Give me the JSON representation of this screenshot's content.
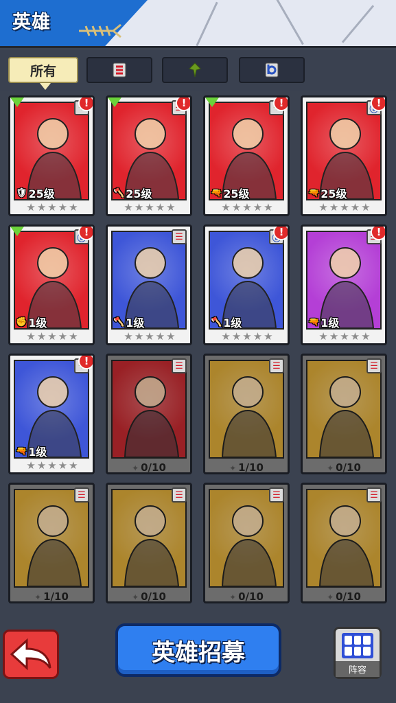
{
  "header": {
    "title": "英雄"
  },
  "filters": [
    {
      "label": "所有",
      "active": true
    },
    {
      "icon": "red-faction-icon",
      "color": "#d31d2a"
    },
    {
      "icon": "green-faction-icon",
      "color": "#6a9a1e"
    },
    {
      "icon": "blue-faction-icon",
      "color": "#2a53c0"
    }
  ],
  "heroes": [
    {
      "level": "25级",
      "bg": "#e0242d",
      "faction": "green",
      "alert": true,
      "new": true,
      "weapon": "shield",
      "stars": 5,
      "locked": false
    },
    {
      "level": "25级",
      "bg": "#e0242d",
      "faction": "red",
      "alert": true,
      "new": true,
      "weapon": "axe",
      "stars": 5,
      "locked": false
    },
    {
      "level": "25级",
      "bg": "#e0242d",
      "faction": "green",
      "alert": true,
      "new": true,
      "weapon": "gun",
      "stars": 5,
      "locked": false
    },
    {
      "level": "25级",
      "bg": "#e0242d",
      "faction": "blue",
      "alert": true,
      "new": false,
      "weapon": "gun",
      "stars": 5,
      "locked": false
    },
    {
      "level": "1级",
      "bg": "#e0242d",
      "faction": "blue",
      "alert": true,
      "new": true,
      "weapon": "fist",
      "stars": 5,
      "locked": false
    },
    {
      "level": "1级",
      "bg": "#3e56d8",
      "faction": "red",
      "alert": false,
      "new": false,
      "weapon": "axe",
      "stars": 5,
      "locked": false
    },
    {
      "level": "1级",
      "bg": "#3e56d8",
      "faction": "blue",
      "alert": true,
      "new": false,
      "weapon": "axe",
      "stars": 5,
      "locked": false
    },
    {
      "level": "1级",
      "bg": "#b43fd6",
      "faction": "red",
      "alert": true,
      "new": false,
      "weapon": "gun",
      "stars": 5,
      "locked": false
    },
    {
      "level": "1级",
      "bg": "#3e56d8",
      "faction": "green",
      "alert": true,
      "new": false,
      "weapon": "gun",
      "stars": 5,
      "locked": false
    },
    {
      "progress": "0/10",
      "bg": "#c8242a",
      "faction": "red",
      "locked": true
    },
    {
      "progress": "1/10",
      "bg": "#d7a22a",
      "faction": "red",
      "locked": true
    },
    {
      "progress": "0/10",
      "bg": "#d7a22a",
      "faction": "red",
      "locked": true
    },
    {
      "progress": "1/10",
      "bg": "#d7a22a",
      "faction": "red",
      "locked": true
    },
    {
      "progress": "0/10",
      "bg": "#d7a22a",
      "faction": "red",
      "locked": true
    },
    {
      "progress": "0/10",
      "bg": "#d7a22a",
      "faction": "red",
      "locked": true
    },
    {
      "progress": "0/10",
      "bg": "#d7a22a",
      "faction": "red",
      "locked": true
    }
  ],
  "bottom": {
    "recruit_label": "英雄招募",
    "lineup_label": "阵容"
  }
}
